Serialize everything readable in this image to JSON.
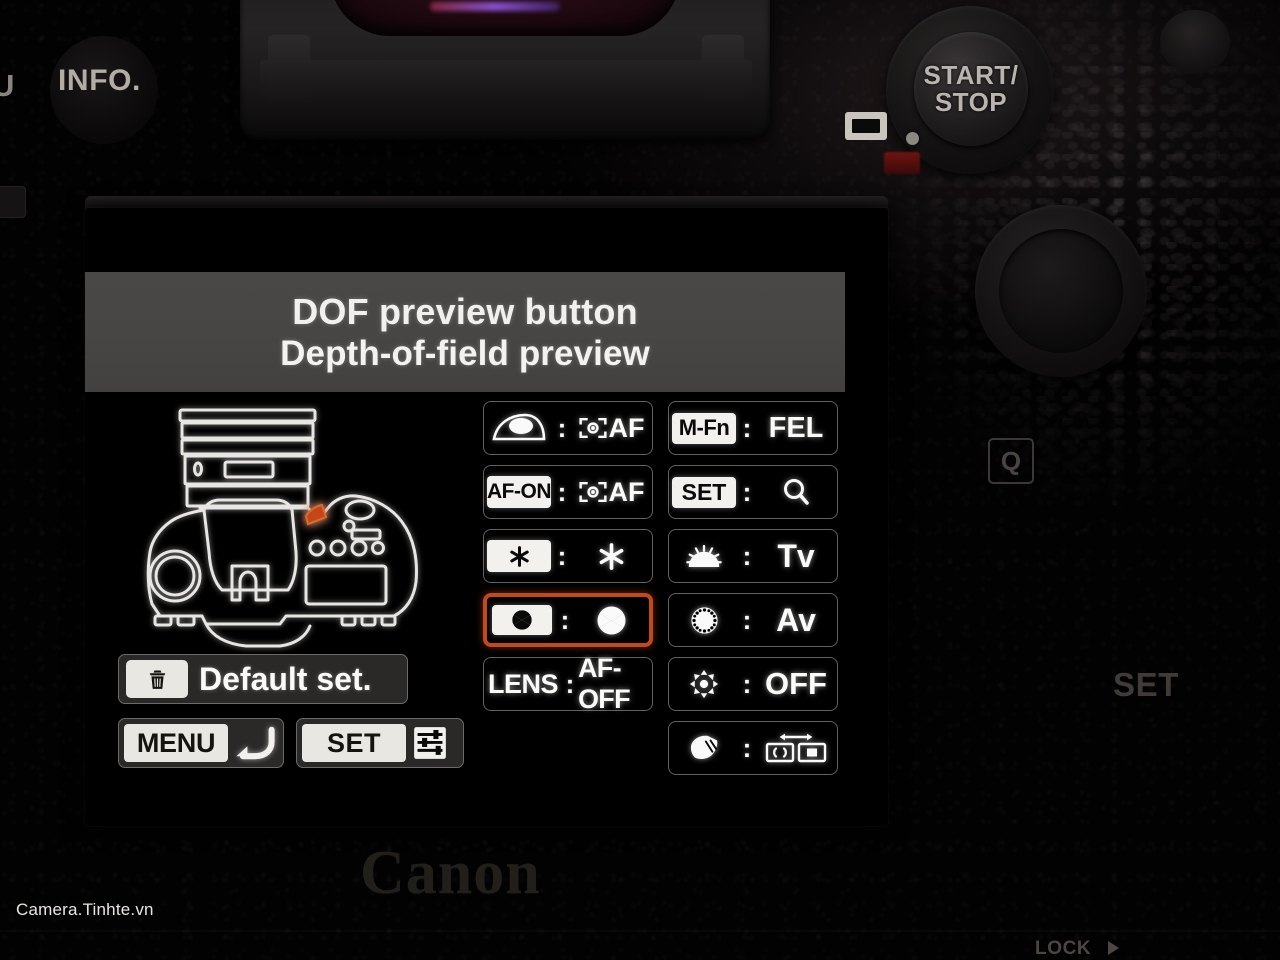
{
  "screen": {
    "header": {
      "title": "DOF preview button",
      "subtitle": "Depth-of-field preview"
    },
    "illustration": {
      "name": "camera-top-view-diagram",
      "highlight_color": "#c4471a",
      "line_color": "#e8e6e2"
    },
    "default_set_button": {
      "label": "Default set.",
      "icon": "trash-icon"
    },
    "menu_button": {
      "label": "MENU",
      "icon": "back-arrow-icon"
    },
    "set_button": {
      "label": "SET",
      "icon": "settings-sliders-icon"
    },
    "function_rows_left": [
      {
        "control_icon": "shutter-button-halfpress-icon",
        "control_label": "",
        "control_is_chip": false,
        "separator": ":",
        "assignment_icon": "af-frame-icon",
        "assignment_label": "AF",
        "selected": false
      },
      {
        "control_icon": "",
        "control_label": "AF-ON",
        "control_is_chip": true,
        "separator": ":",
        "assignment_icon": "af-frame-icon",
        "assignment_label": "AF",
        "selected": false
      },
      {
        "control_icon": "asterisk-ae-lock-icon",
        "control_label": "",
        "control_is_chip": true,
        "separator": ":",
        "assignment_icon": "asterisk-ae-lock-icon",
        "assignment_label": "",
        "selected": false
      },
      {
        "control_icon": "aperture-dof-icon",
        "control_label": "",
        "control_is_chip": true,
        "separator": ":",
        "assignment_icon": "aperture-dof-icon",
        "assignment_label": "",
        "selected": true
      },
      {
        "control_icon": "",
        "control_label": "LENS",
        "control_is_chip": false,
        "separator": ":",
        "assignment_icon": "",
        "assignment_label": "AF-OFF",
        "selected": false
      }
    ],
    "function_rows_right": [
      {
        "control_icon": "",
        "control_label": "M-Fn",
        "control_is_chip": true,
        "separator": ":",
        "assignment_icon": "",
        "assignment_label": "FEL",
        "selected": false
      },
      {
        "control_icon": "",
        "control_label": "SET",
        "control_is_chip": true,
        "separator": ":",
        "assignment_icon": "magnifier-icon",
        "assignment_label": "",
        "selected": false
      },
      {
        "control_icon": "main-dial-icon",
        "control_label": "",
        "control_is_chip": false,
        "separator": ":",
        "assignment_icon": "",
        "assignment_label": "Tv",
        "selected": false
      },
      {
        "control_icon": "quick-control-dial-icon",
        "control_label": "",
        "control_is_chip": false,
        "separator": ":",
        "assignment_icon": "",
        "assignment_label": "Av",
        "selected": false
      },
      {
        "control_icon": "multi-controller-icon",
        "control_label": "",
        "control_is_chip": false,
        "separator": ":",
        "assignment_icon": "",
        "assignment_label": "OFF",
        "selected": false
      },
      {
        "control_icon": "touch-pad-icon",
        "control_label": "",
        "control_is_chip": false,
        "separator": ":",
        "assignment_icon": "card-switch-icon",
        "assignment_label": "",
        "selected": false
      }
    ]
  },
  "camera_body": {
    "info_button": "INFO.",
    "menu_button_partial": "U",
    "start_stop_button_line1": "START/",
    "start_stop_button_line2": "STOP",
    "quick_menu_button": "Q",
    "set_label": "SET",
    "brand": "Canon",
    "lock_label": "LOCK"
  },
  "watermark": "Camera.Tinhte.vn"
}
